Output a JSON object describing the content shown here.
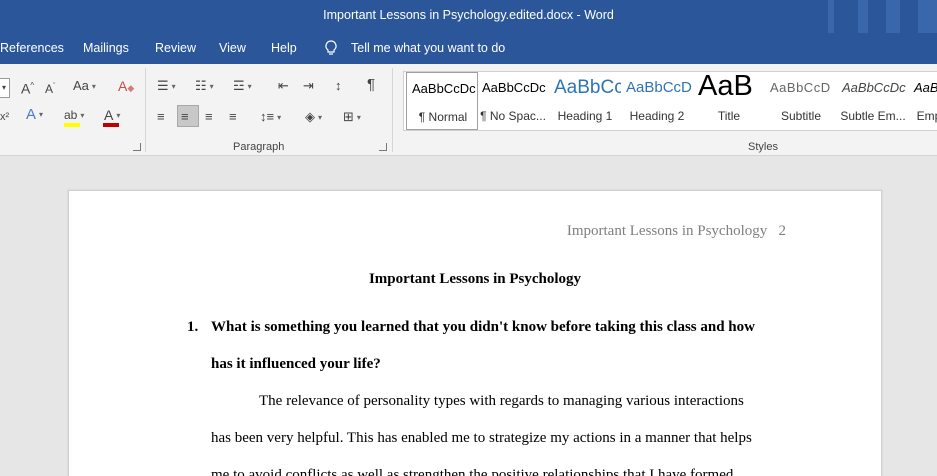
{
  "window": {
    "title": "Important Lessons in Psychology.edited.docx  -  Word"
  },
  "menu": {
    "tabs": [
      "References",
      "Mailings",
      "Review",
      "View",
      "Help"
    ],
    "tell_me": "Tell me what you want to do"
  },
  "ribbon": {
    "groups": {
      "paragraph": "Paragraph",
      "styles": "Styles"
    },
    "styles": [
      {
        "sample": "AaBbCcDc",
        "name": "¶ Normal"
      },
      {
        "sample": "AaBbCcDc",
        "name": "¶ No Spac..."
      },
      {
        "sample": "AaBbCc",
        "name": "Heading 1"
      },
      {
        "sample": "AaBbCcD",
        "name": "Heading 2"
      },
      {
        "sample": "AaB",
        "name": "Title"
      },
      {
        "sample": "AaBbCcD",
        "name": "Subtitle"
      },
      {
        "sample": "AaBbCcDc",
        "name": "Subtle Em..."
      },
      {
        "sample": "AaBl",
        "name": "Emp"
      }
    ],
    "colors": {
      "highlight": "#ffff00",
      "font_color": "#c00000",
      "accent": "#2b579a"
    }
  },
  "document": {
    "header": "Important Lessons in Psychology   2",
    "title": "Important Lessons in Psychology",
    "question_number": "1.",
    "question_lines": [
      "What is something you learned that you didn't know before taking this class and how",
      "has it influenced your life?"
    ],
    "paragraph_lines": [
      "The relevance of personality types with regards to managing various interactions",
      "has been very helpful. This has enabled me to strategize my actions in a manner that helps",
      "me to avoid conflicts as well as strengthen the positive relationships that I have formed."
    ]
  }
}
